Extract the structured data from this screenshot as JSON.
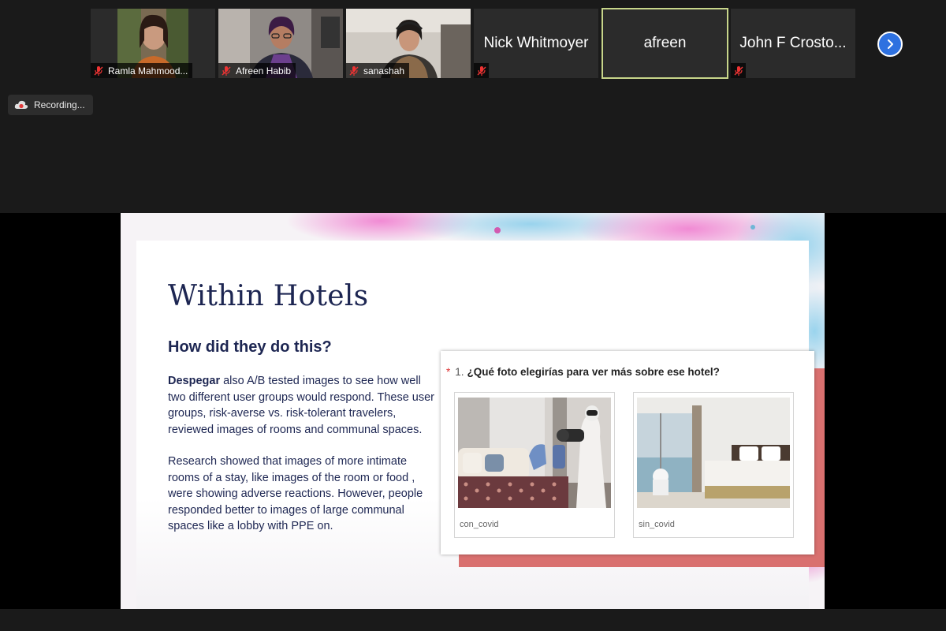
{
  "participants": [
    {
      "name": "Ramla Mahmood...",
      "video": true
    },
    {
      "name": "Afreen Habib",
      "video": true
    },
    {
      "name": "sanashah",
      "video": true
    },
    {
      "name": "Nick Whitmoyer",
      "video": false
    },
    {
      "name": "afreen",
      "video": false,
      "active": true
    },
    {
      "name": "John F Crosto...",
      "video": false
    }
  ],
  "recording_label": "Recording...",
  "slide": {
    "title": "Within Hotels",
    "subtitle": "How did they do this?",
    "para1_bold": "Despegar",
    "para1_rest": " also A/B tested images to see how well two different user groups would respond. These user groups, risk-averse vs. risk-tolerant travelers, reviewed images of rooms and communal spaces.",
    "para2": "Research showed that images of more intimate rooms of a stay, like images of the room or food , were showing adverse reactions. However, people responded better to images of  large communal spaces like a lobby with PPE on.",
    "survey": {
      "asterisk": "*",
      "number": "1.",
      "question": "¿Qué foto elegirías para ver más sobre ese hotel?",
      "options": [
        {
          "label": "con_covid"
        },
        {
          "label": "sin_covid"
        }
      ]
    }
  },
  "colors": {
    "title_navy": "#1d2652",
    "accent_pink": "#d9706f",
    "next_button": "#2e71e0",
    "active_border": "#c7d58a"
  }
}
